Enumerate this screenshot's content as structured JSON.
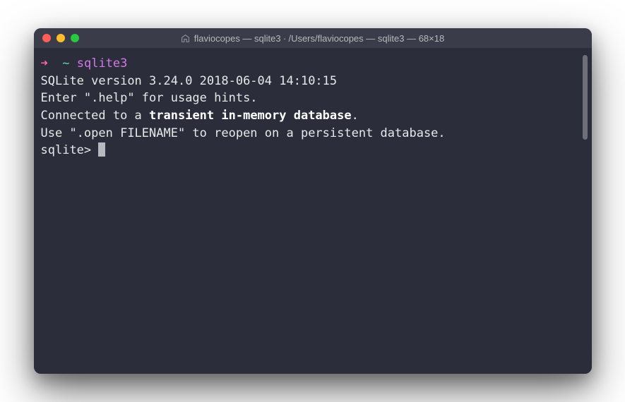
{
  "window": {
    "title": "flaviocopes — sqlite3 ∙ /Users/flaviocopes — sqlite3 — 68×18"
  },
  "prompt": {
    "arrow": "➜",
    "tilde": "~",
    "command": "sqlite3"
  },
  "output": {
    "line1": "SQLite version 3.24.0 2018-06-04 14:10:15",
    "line2": "Enter \".help\" for usage hints.",
    "line3_prefix": "Connected to a ",
    "line3_bold": "transient in-memory database",
    "line3_suffix": ".",
    "line4": "Use \".open FILENAME\" to reopen on a persistent database.",
    "sqlite_prompt": "sqlite> "
  }
}
